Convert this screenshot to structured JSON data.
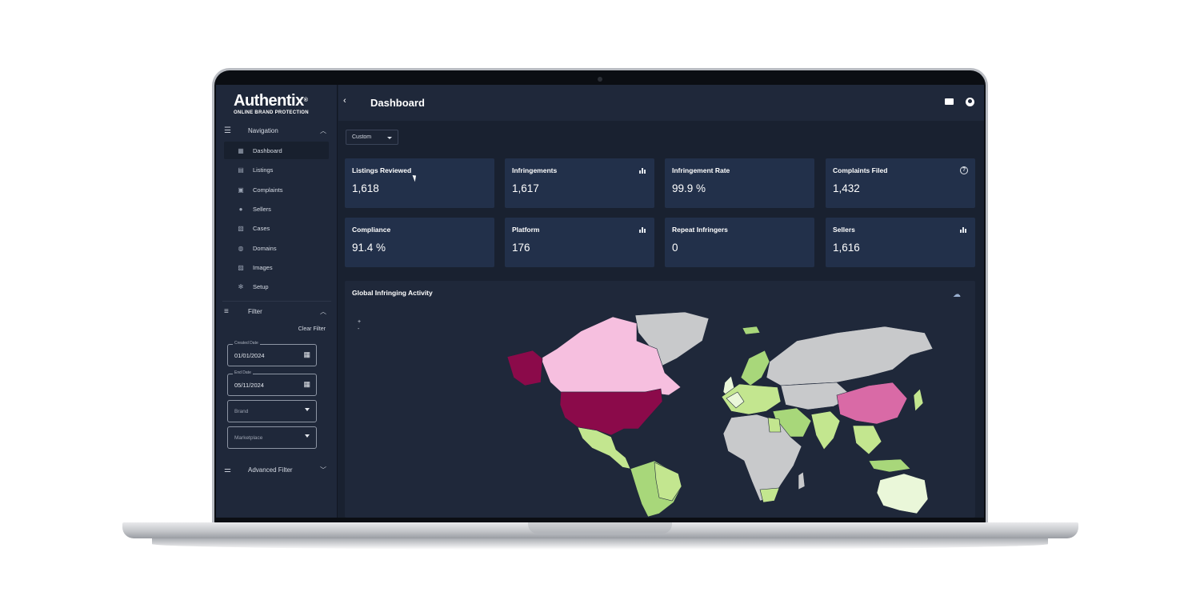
{
  "brand": {
    "logo_main": "Authentix",
    "logo_reg": "®",
    "logo_sub": "ONLINE BRAND PROTECTION"
  },
  "header": {
    "title": "Dashboard"
  },
  "sidebar": {
    "navigation_label": "Navigation",
    "items": [
      {
        "label": "Dashboard",
        "icon": "dashboard-icon"
      },
      {
        "label": "Listings",
        "icon": "listings-icon"
      },
      {
        "label": "Complaints",
        "icon": "complaints-icon"
      },
      {
        "label": "Sellers",
        "icon": "sellers-icon"
      },
      {
        "label": "Cases",
        "icon": "cases-icon"
      },
      {
        "label": "Domains",
        "icon": "globe-icon"
      },
      {
        "label": "Images",
        "icon": "images-icon"
      },
      {
        "label": "Setup",
        "icon": "gear-icon"
      }
    ],
    "active_item": "Dashboard",
    "filter_label": "Filter",
    "clear_filter": "Clear Filter",
    "created_date": {
      "legend": "Created Date",
      "value": "01/01/2024"
    },
    "end_date": {
      "legend": "End Date",
      "value": "05/11/2024"
    },
    "brand_select": {
      "placeholder": "Brand"
    },
    "marketplace_select": {
      "placeholder": "Marketplace"
    },
    "advanced_filter_label": "Advanced Filter"
  },
  "range": {
    "selected": "Custom"
  },
  "cards": [
    {
      "title": "Listings Reviewed",
      "value": "1,618",
      "icon": null
    },
    {
      "title": "Infringements",
      "value": "1,617",
      "icon": "bar-chart-icon"
    },
    {
      "title": "Infringement Rate",
      "value": "99.9 %",
      "icon": null
    },
    {
      "title": "Complaints Filed",
      "value": "1,432",
      "icon": "help-icon"
    },
    {
      "title": "Compliance",
      "value": "91.4 %",
      "icon": null
    },
    {
      "title": "Platform",
      "value": "176",
      "icon": "bar-chart-icon"
    },
    {
      "title": "Repeat Infringers",
      "value": "0",
      "icon": null
    },
    {
      "title": "Sellers",
      "value": "1,616",
      "icon": "bar-chart-icon"
    }
  ],
  "map": {
    "title": "Global Infringing Activity",
    "zoom_in": "+",
    "zoom_out": "-",
    "colors": {
      "highest": "#8b0a4a",
      "high": "#d96aa6",
      "medium": "#f6bfdf",
      "low": "#c3e68f",
      "lower": "#a8d77a",
      "lowest": "#eaf7d9",
      "none": "#c8c9cb"
    }
  }
}
